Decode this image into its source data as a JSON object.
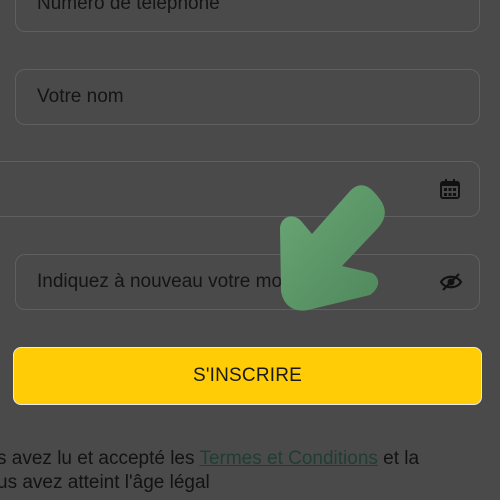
{
  "form": {
    "phone_placeholder": "Numéro de téléphone",
    "name_placeholder": "Votre nom",
    "confirm_password_placeholder": "Indiquez à nouveau votre mot de passe"
  },
  "signup_button": {
    "label": "S'INSCRIRE",
    "color": "#ffcc05"
  },
  "terms": {
    "line1_before": "s avez lu et accepté les ",
    "link_text": "Termes et Conditions",
    "line1_after": " et la",
    "line2": "us avez atteint l'âge légal"
  },
  "icons": {
    "date_field": "calendar-icon",
    "password_field": "eye-off-icon",
    "overlay": "arrow-pointer-icon"
  },
  "overlay_color": "#5b9467"
}
